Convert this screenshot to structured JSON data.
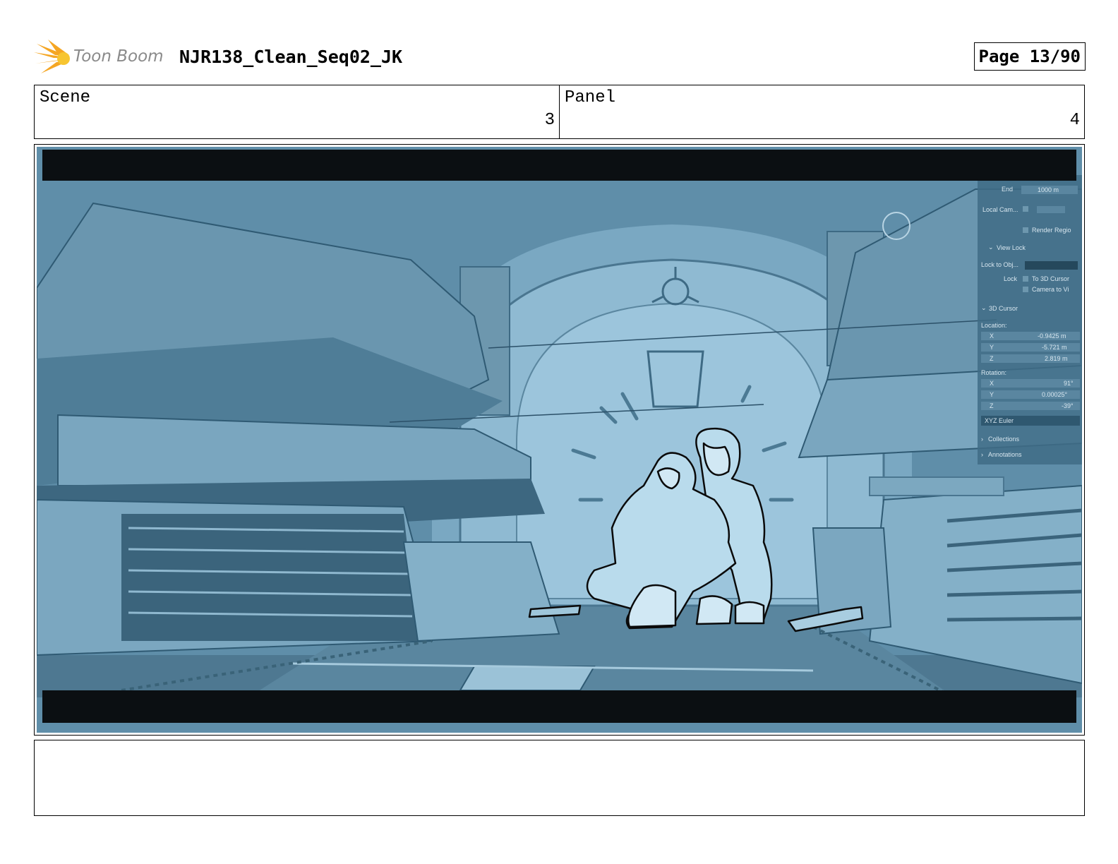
{
  "header": {
    "logo_text": "Toon Boom",
    "title": "NJR138_Clean_Seq02_JK",
    "page_label": "Page 13/90"
  },
  "panel_info": {
    "scene_label": "Scene",
    "scene_value": "3",
    "panel_label": "Panel",
    "panel_value": "4"
  },
  "viewport_ui": {
    "end_label": "End",
    "end_value": "1000 m",
    "local_camera": "Local Cam...",
    "render_region": "Render Regio",
    "view_lock": "View Lock",
    "lock_to_object": "Lock to Obj...",
    "lock": "Lock",
    "to_3d_cursor": "To 3D Cursor",
    "camera_to_view": "Camera to Vi",
    "cursor_3d": "3D Cursor",
    "location": "Location:",
    "loc_x_label": "X",
    "loc_x": "-0.9425 m",
    "loc_y_label": "Y",
    "loc_y": "-5.721 m",
    "loc_z_label": "Z",
    "loc_z": "2.819 m",
    "rotation": "Rotation:",
    "rot_x_label": "X",
    "rot_x": "91°",
    "rot_y_label": "Y",
    "rot_y": "0.00025°",
    "rot_z_label": "Z",
    "rot_z": "-39°",
    "euler": "XYZ Euler",
    "collections": "Collections",
    "annotations": "Annotations"
  },
  "notes": {
    "text": ""
  },
  "colors": {
    "logo_orange": "#f5a623",
    "logo_text": "#8a8a8a",
    "scene_tint": "#5f8ea9",
    "letterbox": "#0b0f12"
  }
}
